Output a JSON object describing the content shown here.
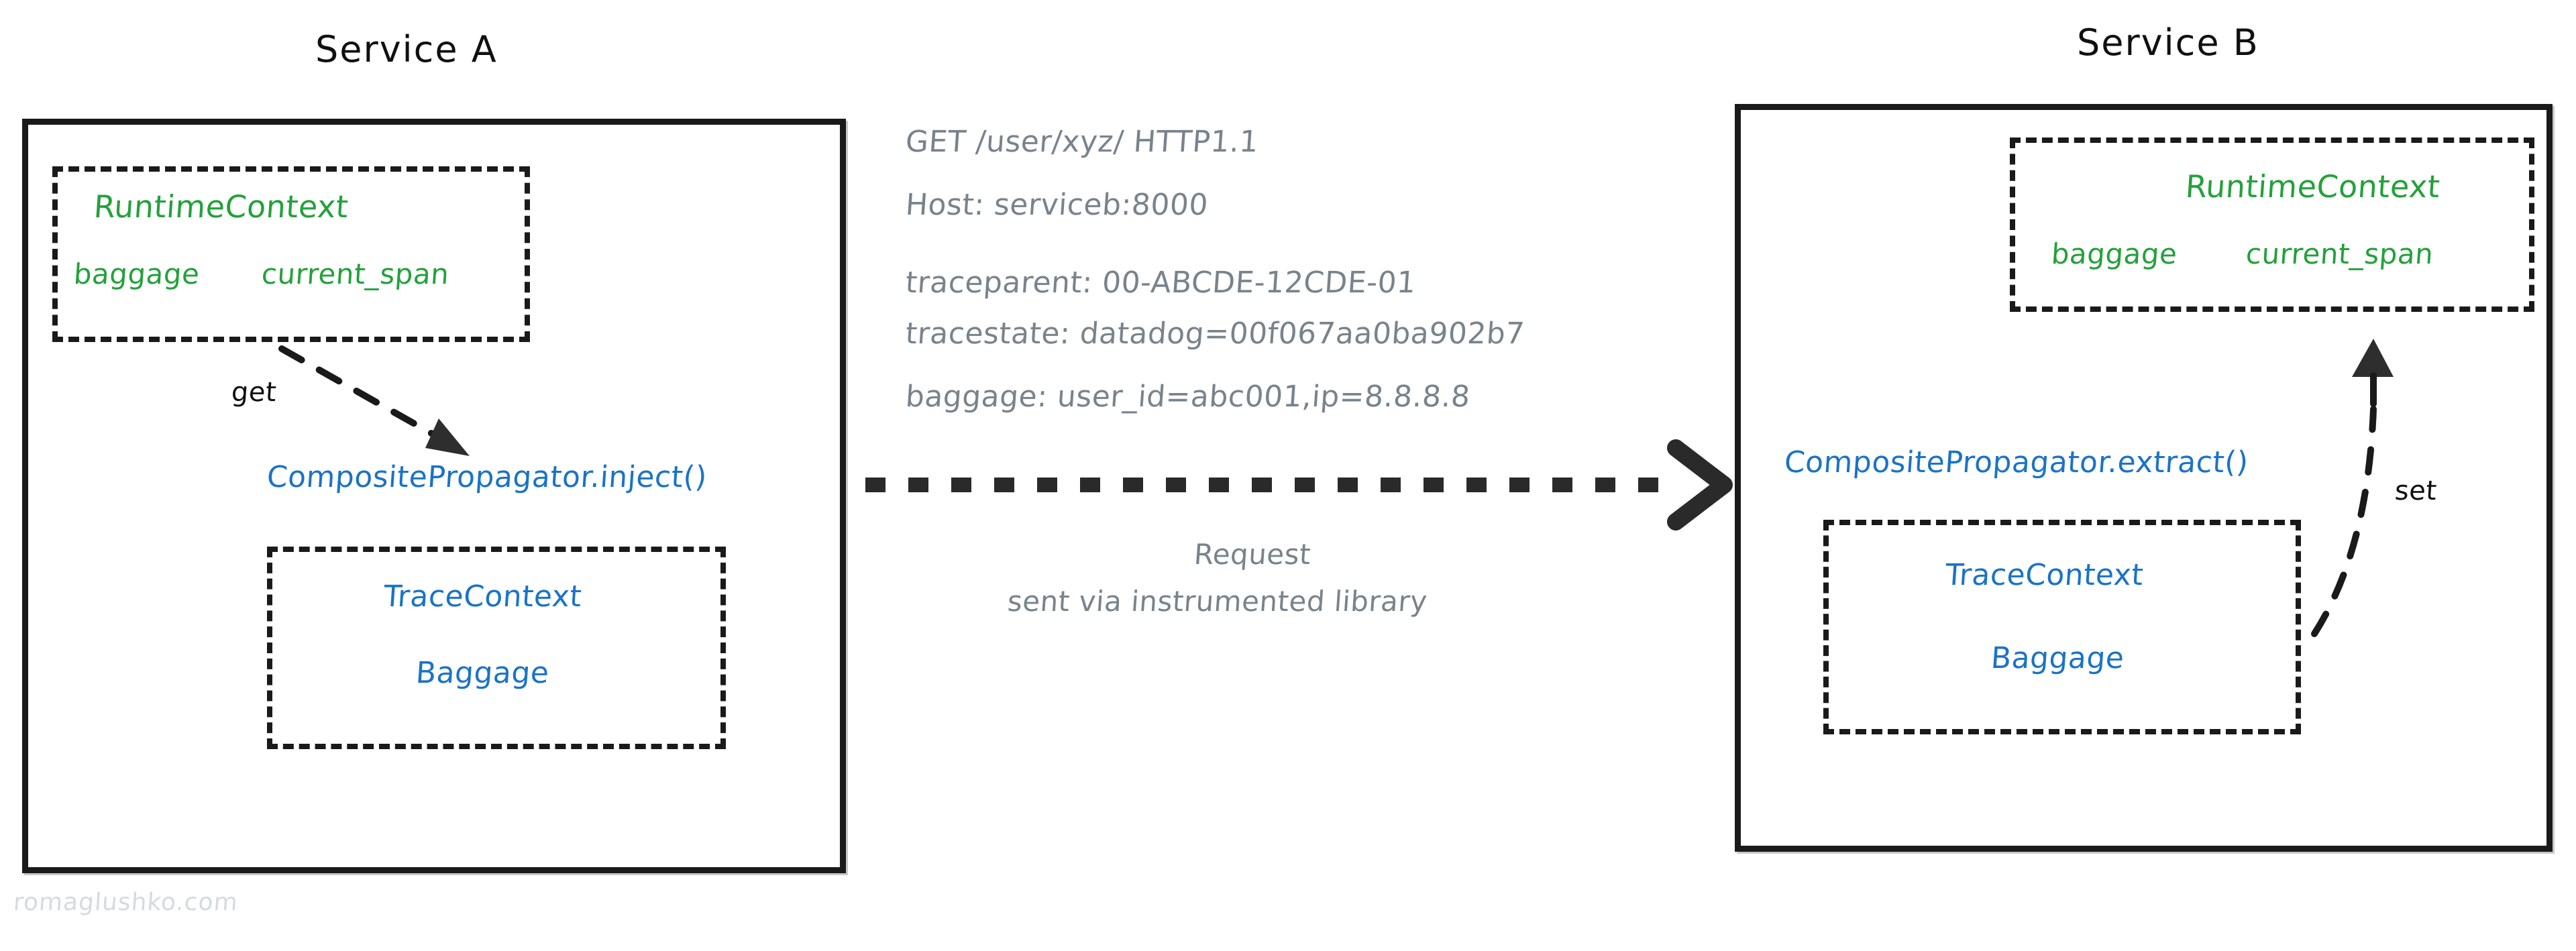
{
  "diagram": {
    "title_left": "Service A",
    "title_right": "Service B",
    "watermark": "romaglushko.com"
  },
  "service_a": {
    "title": "Service A",
    "runtime_context": {
      "name": "RuntimeContext",
      "field_baggage": "baggage",
      "field_current_span": "current_span"
    },
    "get_label": "get",
    "propagator_call": "CompositePropagator.inject()",
    "carrier": {
      "trace_context": "TraceContext",
      "baggage": "Baggage"
    }
  },
  "service_b": {
    "title": "Service B",
    "runtime_context": {
      "name": "RuntimeContext",
      "field_baggage": "baggage",
      "field_current_span": "current_span"
    },
    "set_label": "set",
    "propagator_call": "CompositePropagator.extract()",
    "carrier": {
      "trace_context": "TraceContext",
      "baggage": "Baggage"
    }
  },
  "request": {
    "request_line": "GET /user/xyz/ HTTP1.1",
    "host_header": "Host: serviceb:8000",
    "traceparent_header": "traceparent: 00-ABCDE-12CDE-01",
    "tracestate_header": "tracestate: datadog=00f067aa0ba902b7",
    "baggage_header": "baggage: user_id=abc001,ip=8.8.8.8",
    "note_line1": "Request",
    "note_line2": "sent via instrumented library"
  },
  "colors": {
    "green": "#23a13b",
    "blue": "#1a73c7",
    "gray": "#78838c",
    "black": "#101010",
    "watermark": "#d4dbe0"
  }
}
